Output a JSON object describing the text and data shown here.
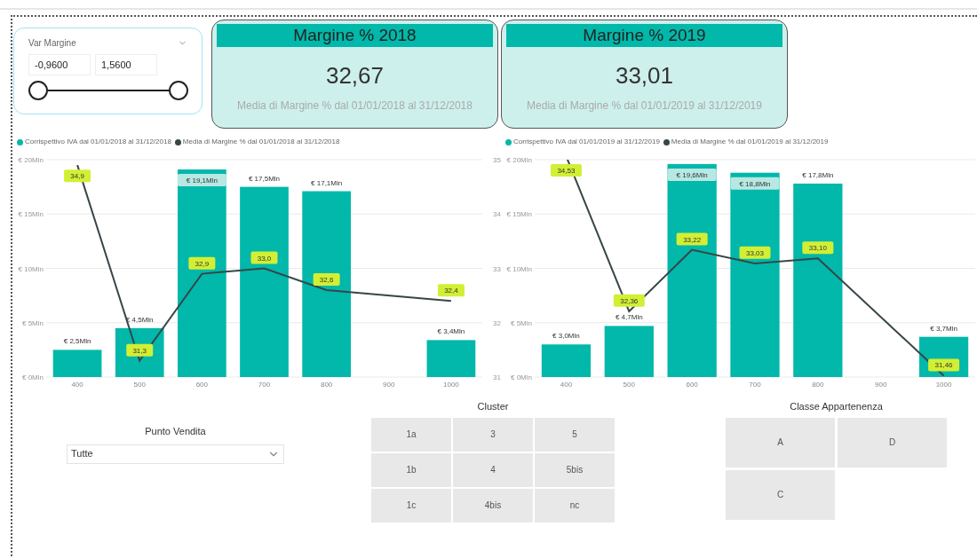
{
  "slicer": {
    "title": "Var Margine",
    "min_value": "-0,9600",
    "max_value": "1,5600",
    "handles": [
      {
        "level": 0
      },
      {
        "level": 1
      }
    ]
  },
  "kpi_cards": [
    {
      "title": "Margine % 2018",
      "value": "32,67",
      "caption": "Media di Margine % dal 01/01/2018 al 31/12/2018"
    },
    {
      "title": "Margine % 2019",
      "value": "33,01",
      "caption": "Media di Margine % dal 01/01/2019 al 31/12/2019"
    }
  ],
  "charts": [
    {
      "bars": {
        "chart_data": {
          "type": "bar",
          "categories": [
            "400",
            "500",
            "600",
            "700",
            "800",
            "900",
            "1000"
          ],
          "ylim": [
            0,
            20
          ],
          "yticks": [
            {
              "value": 0,
              "label": "€ 0Mln"
            },
            {
              "value": 5,
              "label": "€ 5Mln"
            },
            {
              "value": 10,
              "label": "€ 10Mln"
            },
            {
              "value": 15,
              "label": "€ 15Mln"
            },
            {
              "value": 20,
              "label": "€ 20Mln"
            }
          ],
          "grid": true,
          "series": [
            {
              "name": "Corrispettivo IVA dal 01/01/2018 al 31/12/2018",
              "color": "#01b8aa",
              "values": [
                2.5,
                4.5,
                19.1,
                17.5,
                17.1,
                null,
                3.4
              ],
              "value_labels": [
                "€ 2,5Mln",
                "€ 4,5Mln",
                "€ 19,1Mln",
                "€ 17,5Mln",
                "€ 17,1Mln",
                null,
                "€ 3,4Mln"
              ]
            }
          ]
        }
      },
      "line": {
        "chart_data": {
          "type": "line",
          "ylim": [
            31,
            35
          ],
          "yticks": [
            31,
            32,
            33,
            34,
            35
          ],
          "series": [
            {
              "name": "Media di Margine % dal 01/01/2018 al 31/12/2018",
              "color": "#374649",
              "values": [
                34.9,
                31.3,
                32.9,
                33.0,
                32.6,
                null,
                32.4
              ],
              "value_labels": [
                "34,9",
                "31,3",
                "32,9",
                "33,0",
                "32,6",
                null,
                "32,4"
              ]
            }
          ]
        }
      }
    },
    {
      "bars": {
        "chart_data": {
          "type": "bar",
          "categories": [
            "400",
            "500",
            "600",
            "700",
            "800",
            "900",
            "1000"
          ],
          "ylim": [
            0,
            20
          ],
          "yticks": [
            {
              "value": 0,
              "label": "€ 0Mln"
            },
            {
              "value": 5,
              "label": "€ 5Mln"
            },
            {
              "value": 10,
              "label": "€ 10Mln"
            },
            {
              "value": 15,
              "label": "€ 15Mln"
            },
            {
              "value": 20,
              "label": "€ 20Mln"
            }
          ],
          "grid": true,
          "series": [
            {
              "name": "Corrispettivo IVA dal 01/01/2019 al 31/12/2019",
              "color": "#01b8aa",
              "values": [
                3.0,
                4.7,
                19.6,
                18.8,
                17.8,
                null,
                3.7
              ],
              "value_labels": [
                "€ 3,0Mln",
                "€ 4,7Mln",
                "€ 19,6Mln",
                "€ 18,8Mln",
                "€ 17,8Mln",
                null,
                "€ 3,7Mln"
              ]
            }
          ]
        }
      },
      "line": {
        "chart_data": {
          "type": "line",
          "series": [
            {
              "name": "Media di Margine % dal 01/01/2019 al 31/12/2019",
              "color": "#374649",
              "values": [
                34.53,
                32.36,
                33.22,
                33.03,
                33.1,
                null,
                31.46
              ],
              "value_labels": [
                "34,53",
                "32,36",
                "33,22",
                "33,03",
                "33,10",
                null,
                "31,46"
              ]
            }
          ]
        }
      }
    }
  ],
  "punto_vendita": {
    "title": "Punto Vendita",
    "value": "Tutte"
  },
  "cluster": {
    "title": "Cluster",
    "items": [
      {
        "label": "1a",
        "selected": false
      },
      {
        "label": "3",
        "selected": false
      },
      {
        "label": "5",
        "selected": false
      },
      {
        "label": "1b",
        "selected": false
      },
      {
        "label": "4",
        "selected": false
      },
      {
        "label": "5bis",
        "selected": false
      },
      {
        "label": "1c",
        "selected": false
      },
      {
        "label": "4bis",
        "selected": false
      },
      {
        "label": "nc",
        "selected": false
      }
    ]
  },
  "classe_appartenenza": {
    "title": "Classe Appartenenza",
    "items": [
      {
        "label": "A",
        "selected": false
      },
      {
        "label": "D",
        "selected": false
      },
      {
        "label": "C",
        "selected": false
      }
    ]
  }
}
